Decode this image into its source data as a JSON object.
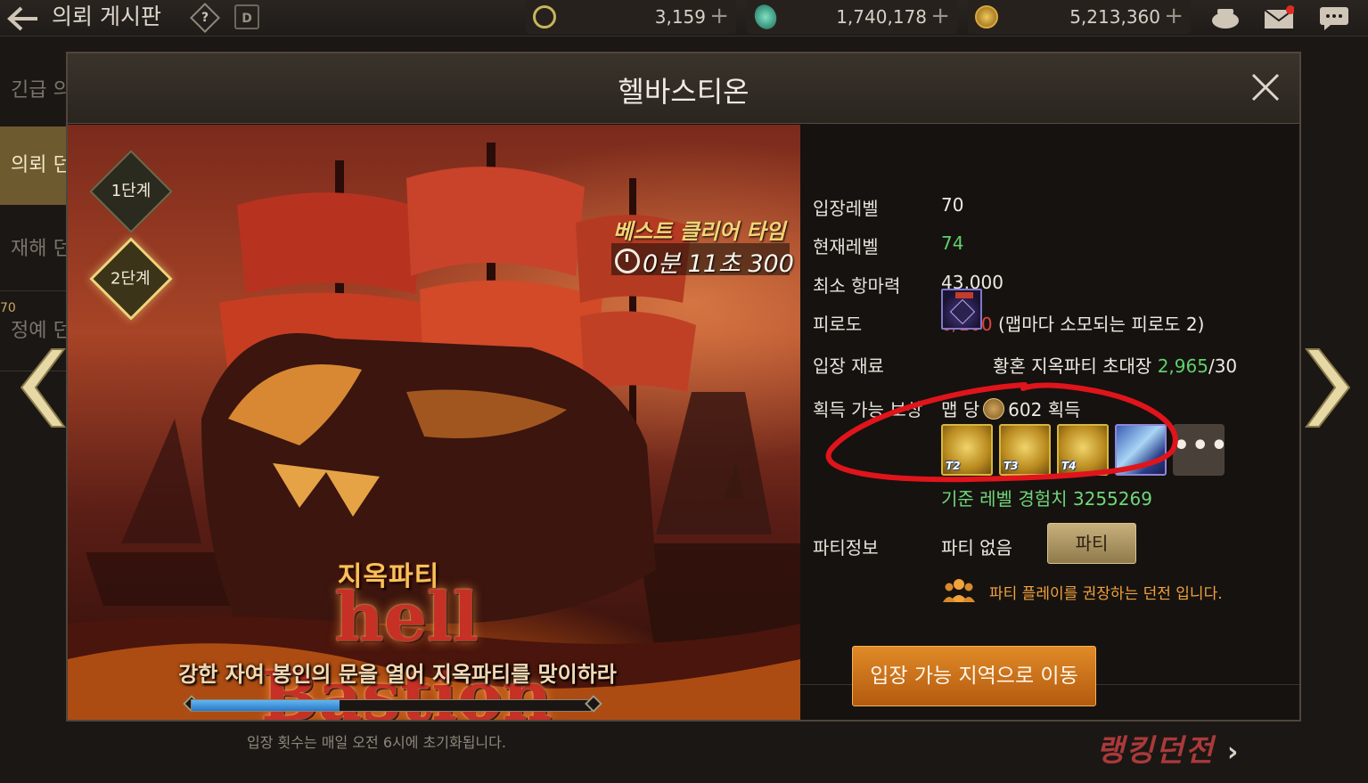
{
  "topbar": {
    "title": "의뢰 게시판",
    "calendar_label": "D",
    "currencies": [
      {
        "name": "c-coin",
        "value": "3,159",
        "color": "#c9b45a"
      },
      {
        "name": "crystal",
        "value": "1,740,178",
        "color": "#2fa88a"
      },
      {
        "name": "gold",
        "value": "5,213,360",
        "color": "#c99a2a"
      }
    ],
    "plus": "+"
  },
  "sidemenu": {
    "items": [
      "긴급 의뢰",
      "의뢰 던전",
      "재해 던전",
      "정예 던전"
    ],
    "level_badge": "70"
  },
  "modal": {
    "title": "헬바스티온",
    "stages": [
      "1단계",
      "2단계"
    ],
    "active_stage": "2단계",
    "best_clear_label": "베스트 클리어 타임",
    "best_clear_time": "0분 11초 300",
    "logo_sub": "지옥파티",
    "logo_main": "hell Bastion",
    "logo_tagline": "강한 자여 봉인의 문을 열어 지옥파티를 맞이하라",
    "progress": 0.37
  },
  "info": {
    "entry_level_label": "입장레벨",
    "entry_level": "70",
    "current_level_label": "현재레벨",
    "current_level": "74",
    "min_resist_label": "최소 항마력",
    "min_resist": "43,000",
    "fatigue_label": "피로도",
    "fatigue_value": "0/100",
    "fatigue_note": "(맵마다 소모되는 피로도 2)",
    "material_label": "입장 재료",
    "material_name": "황혼 지옥파티 초대장",
    "material_have": "2,965",
    "material_need": "/30",
    "reward_label": "획득 가능 보상",
    "reward_per_map": "맵 당",
    "reward_amount": "602 획득",
    "reward_tiers": [
      "T2",
      "T3",
      "T4"
    ],
    "more": "•••",
    "exp_text": "기준 레벨 경험치 3255269",
    "party_label": "파티정보",
    "party_value": "파티 없음",
    "party_button": "파티",
    "party_note": "파티 플레이를 권장하는 던전 입니다."
  },
  "enter_button": "입장 가능 지역으로 이동",
  "footer_note": "입장 횟수는 매일 오전 6시에 초기화됩니다.",
  "ranking_link": "랭킹던전",
  "ranking_chevron": "›",
  "colors": {
    "accent_gold": "#efd37a",
    "exp_green": "#6fd778",
    "fatigue_red": "#e0433b",
    "enter_orange": "#d2771f",
    "annotation_red": "#e0141b"
  }
}
